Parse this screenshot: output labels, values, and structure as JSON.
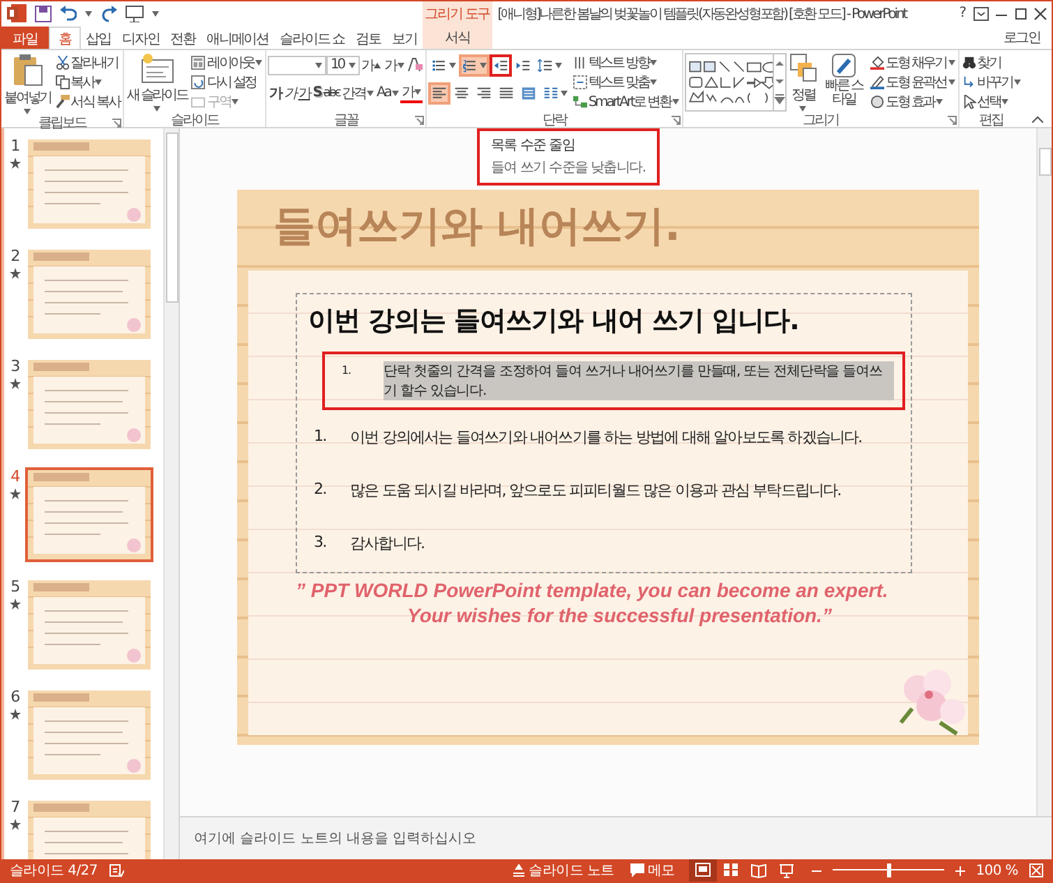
{
  "title_bar": {
    "title": "[애니형]나른한 봄날의 벚꽃놀이 템플릿(자동완성형포함) [호환 모드] - PowerPoint",
    "contextual_group": "그리기 도구",
    "help_button": "?",
    "account": "로그인"
  },
  "tabs": [
    {
      "label": "파일",
      "kind": "file",
      "selected": false
    },
    {
      "label": "홈",
      "kind": "tab",
      "selected": true
    },
    {
      "label": "삽입",
      "kind": "tab",
      "selected": false
    },
    {
      "label": "디자인",
      "kind": "tab",
      "selected": false
    },
    {
      "label": "전환",
      "kind": "tab",
      "selected": false
    },
    {
      "label": "애니메이션",
      "kind": "tab",
      "selected": false
    },
    {
      "label": "슬라이드 쇼",
      "kind": "tab",
      "selected": false
    },
    {
      "label": "검토",
      "kind": "tab",
      "selected": false
    },
    {
      "label": "보기",
      "kind": "tab",
      "selected": false
    },
    {
      "label": "서식",
      "kind": "contextual",
      "selected": false
    }
  ],
  "ribbon": {
    "clipboard": {
      "label": "클립보드",
      "paste": "붙여넣기",
      "cut": "잘라내기",
      "copy": "복사",
      "format_painter": "서식 복사"
    },
    "slides": {
      "label": "슬라이드",
      "new_slide": "새 슬라이드",
      "layout": "레이아웃",
      "reset": "다시 설정",
      "section": {
        "label": "구역",
        "disabled": true
      }
    },
    "font": {
      "label": "글꼴",
      "size": "10",
      "grow": "가",
      "shrink": "가",
      "buttons": [
        {
          "label": "가",
          "kind": "bold"
        },
        {
          "label": "가",
          "kind": "italic"
        },
        {
          "label": "가",
          "kind": "underline"
        },
        {
          "label": "S",
          "kind": "shadow"
        },
        {
          "label": "abc",
          "kind": "strike"
        },
        {
          "label": "간격",
          "kind": "spacing"
        },
        {
          "label": "Aa",
          "kind": "case"
        },
        {
          "label": "가",
          "kind": "color"
        }
      ]
    },
    "paragraph": {
      "label": "단락",
      "list_buttons": [
        {
          "kind": "bullets",
          "selected": false,
          "highlighted": false
        },
        {
          "kind": "numbering",
          "selected": true,
          "highlighted": false
        },
        {
          "kind": "decrease_indent",
          "selected": false,
          "highlighted": true
        },
        {
          "kind": "increase_indent",
          "selected": false,
          "highlighted": false
        },
        {
          "kind": "line_spacing",
          "selected": false,
          "highlighted": false
        }
      ],
      "align_buttons": [
        {
          "kind": "left",
          "selected": true
        },
        {
          "kind": "center",
          "selected": false
        },
        {
          "kind": "right",
          "selected": false
        },
        {
          "kind": "justify",
          "selected": false
        },
        {
          "kind": "distributed",
          "selected": false
        },
        {
          "kind": "columns",
          "selected": false
        }
      ],
      "text_direction": "텍스트 방향",
      "align_text": "텍스트 맞춤",
      "smartart": "SmartArt로 변환"
    },
    "drawing": {
      "label": "그리기",
      "arrange": "정렬",
      "quick_styles": "빠른 스타일",
      "shape_fill": "도형 채우기",
      "shape_outline": "도형 윤곽선",
      "shape_effects": "도형 효과"
    },
    "editing": {
      "label": "편집",
      "find": "찾기",
      "replace": "바꾸기",
      "select": "선택"
    }
  },
  "tooltip": {
    "title": "목록 수준 줄임",
    "description": "들여 쓰기 수준을 낮춥니다.",
    "highlighted": true
  },
  "slides": [
    {
      "number": "1",
      "selected": false,
      "has_animation": true
    },
    {
      "number": "2",
      "selected": false,
      "has_animation": true
    },
    {
      "number": "3",
      "selected": false,
      "has_animation": true
    },
    {
      "number": "4",
      "selected": true,
      "has_animation": true
    },
    {
      "number": "5",
      "selected": false,
      "has_animation": true
    },
    {
      "number": "6",
      "selected": false,
      "has_animation": true
    },
    {
      "number": "7",
      "selected": false,
      "has_animation": true
    }
  ],
  "slide": {
    "title": "들여쓰기와 내어쓰기.",
    "heading": "이번 강의는 들여쓰기와 내어 쓰기 입니다.",
    "items": [
      {
        "number": "1.",
        "text": "단락 첫줄의 간격을 조정하여 들여 쓰거나 내어쓰기를 만들때, 또는 전체단락을 들여쓰기 할수 있습니다.",
        "kind": "sub",
        "selected": true,
        "highlighted": true
      },
      {
        "number": "1.",
        "text": "이번 강의에서는 들여쓰기와 내어쓰기를 하는 방법에 대해 알아보도록 하겠습니다.",
        "kind": "main",
        "selected": false,
        "highlighted": false
      },
      {
        "number": "2.",
        "text": "많은 도움 되시길 바라며, 앞으로도 피피티월드 많은 이용과 관심 부탁드립니다.",
        "kind": "main",
        "selected": false,
        "highlighted": false
      },
      {
        "number": "3.",
        "text": "감사합니다.",
        "kind": "main",
        "selected": false,
        "highlighted": false
      }
    ],
    "quote": [
      "” PPT WORLD PowerPoint template, you can become an expert.",
      "Your wishes for the successful presentation.”"
    ]
  },
  "notes": {
    "placeholder": "여기에 슬라이드 노트의 내용을 입력하십시오"
  },
  "status_bar": {
    "slide_counter": "슬라이드 4/27",
    "notes_button": "슬라이드 노트",
    "comments_button": "메모",
    "views": [
      {
        "kind": "normal",
        "selected": true
      },
      {
        "kind": "sorter",
        "selected": false
      },
      {
        "kind": "reading",
        "selected": false
      },
      {
        "kind": "slideshow",
        "selected": false
      }
    ],
    "zoom": {
      "level": 0.5,
      "reading": "100 %"
    }
  }
}
